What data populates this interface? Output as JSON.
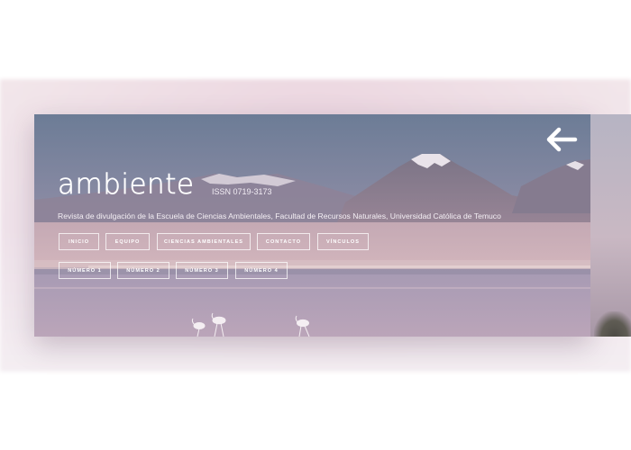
{
  "header": {
    "logo_text": "ambiente",
    "issn": "ISSN 0719-3173",
    "subtitle": "Revista de divulgación de la Escuela de Ciencias Ambientales, Facultad de Recursos Naturales, Universidad Católica de Temuco"
  },
  "nav": {
    "items": [
      {
        "label": "INICIO"
      },
      {
        "label": "EQUIPO"
      },
      {
        "label": "CIENCIAS AMBIENTALES"
      },
      {
        "label": "CONTACTO"
      },
      {
        "label": "VÍNCULOS"
      }
    ]
  },
  "issues": {
    "items": [
      {
        "label": "NÚMERO 1"
      },
      {
        "label": "NÚMERO 2"
      },
      {
        "label": "NÚMERO 3"
      },
      {
        "label": "NÚMERO 4"
      }
    ]
  },
  "icons": {
    "back": "arrow-left-icon",
    "logo": "ambiente-logo"
  },
  "colors": {
    "text": "#ffffff",
    "sky": "#6f7e97",
    "water": "#c6a9b6"
  }
}
